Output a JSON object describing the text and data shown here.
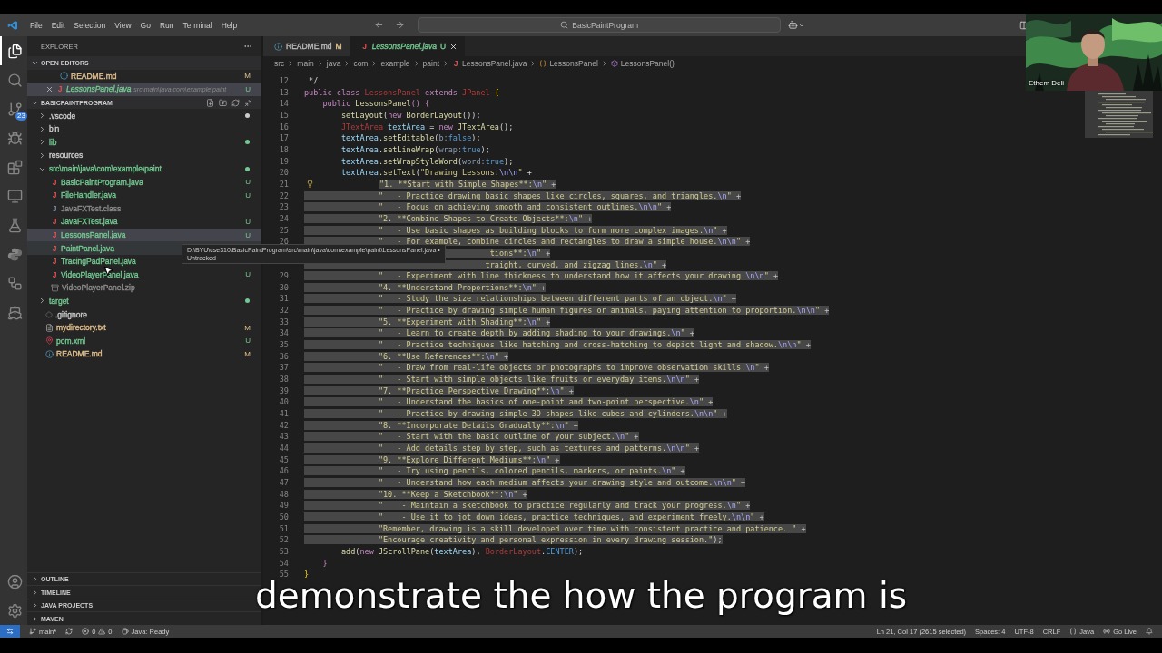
{
  "title_bar": {
    "menus": [
      "File",
      "Edit",
      "Selection",
      "View",
      "Go",
      "Run",
      "Terminal",
      "Help"
    ],
    "search": "BasicPaintProgram"
  },
  "activity_bar": {
    "items": [
      {
        "kind": "explorer",
        "selected": true
      },
      {
        "kind": "search",
        "selected": false
      },
      {
        "kind": "source_control",
        "selected": false,
        "badge": "23"
      },
      {
        "kind": "run",
        "selected": false
      },
      {
        "kind": "extensions",
        "selected": false
      },
      {
        "kind": "remote",
        "selected": false
      },
      {
        "kind": "testing",
        "selected": false
      },
      {
        "kind": "python",
        "selected": false
      },
      {
        "kind": "workflow",
        "selected": false
      },
      {
        "kind": "docker",
        "selected": false
      }
    ],
    "bottom": [
      {
        "kind": "account"
      },
      {
        "kind": "settings"
      }
    ]
  },
  "sidebar": {
    "title": "EXPLORER",
    "open_editors": {
      "title": "OPEN EDITORS",
      "expanded": true,
      "items": [
        {
          "name": "README.md",
          "kind": "md",
          "badge": "M",
          "color": "#e2c08d",
          "selected": false
        },
        {
          "name": "LessonsPanel.java",
          "kind": "java",
          "glyph": "J",
          "path": "src\\main\\java\\com\\example\\paint",
          "badge": "U",
          "color": "#73c991",
          "selected": true
        }
      ]
    },
    "project": {
      "title": "BASICPAINTPROGRAM",
      "expanded": true,
      "items": [
        {
          "name": ".vscode",
          "kind": "folder",
          "expanded": false,
          "color": "#cccccc",
          "dot": true,
          "selected": false,
          "hovered": false
        },
        {
          "name": "bin",
          "kind": "folder",
          "expanded": false,
          "color": "#cccccc",
          "dot": false,
          "selected": false,
          "hovered": false
        },
        {
          "name": "lib",
          "kind": "folder",
          "expanded": false,
          "color": "#73c991",
          "dot": true,
          "selected": false,
          "hovered": false
        },
        {
          "name": "resources",
          "kind": "folder",
          "expanded": false,
          "color": "#cccccc",
          "dot": false,
          "selected": false,
          "hovered": false
        },
        {
          "name": "src\\main\\java\\com\\example\\paint",
          "kind": "folder",
          "expanded": true,
          "color": "#73c991",
          "dot": true,
          "selected": false,
          "hovered": false,
          "children": [
            {
              "name": "BasicPaintProgram.java",
              "kind": "java",
              "glyph": "J",
              "color": "#73c991",
              "badge": "U",
              "selected": false,
              "hovered": false
            },
            {
              "name": "FileHandler.java",
              "kind": "java",
              "glyph": "J",
              "color": "#73c991",
              "badge": "U",
              "selected": false,
              "hovered": false
            },
            {
              "name": "JavaFXTest.class",
              "kind": "class",
              "glyph": "J",
              "color": "#8c8c8c",
              "selected": false,
              "hovered": false
            },
            {
              "name": "JavaFXTest.java",
              "kind": "java",
              "glyph": "J",
              "color": "#73c991",
              "badge": "U",
              "selected": false,
              "hovered": false
            },
            {
              "name": "LessonsPanel.java",
              "kind": "java",
              "glyph": "J",
              "color": "#73c991",
              "badge": "U",
              "selected": true,
              "hovered": false
            },
            {
              "name": "PaintPanel.java",
              "kind": "java",
              "glyph": "J",
              "color": "#73c991",
              "selected": false,
              "hovered": true
            },
            {
              "name": "TracingPadPanel.java",
              "kind": "java",
              "glyph": "J",
              "color": "#73c991",
              "selected": false,
              "hovered": false
            },
            {
              "name": "VideoPlayerPanel.java",
              "kind": "java",
              "glyph": "J",
              "color": "#73c991",
              "badge": "U",
              "selected": false,
              "hovered": false
            },
            {
              "name": "VideoPlayerPanel.zip",
              "kind": "zip",
              "color": "#8c8c8c",
              "selected": false,
              "hovered": false
            }
          ]
        },
        {
          "name": "target",
          "kind": "folder",
          "expanded": false,
          "color": "#73c991",
          "dot": true,
          "selected": false,
          "hovered": false
        },
        {
          "name": ".gitignore",
          "kind": "git",
          "color": "#cccccc",
          "selected": false,
          "hovered": false
        },
        {
          "name": "mydirectory.txt",
          "kind": "txt",
          "color": "#e2c08d",
          "badge": "M",
          "selected": false,
          "hovered": false
        },
        {
          "name": "pom.xml",
          "kind": "xml",
          "color": "#73c991",
          "badge": "U",
          "selected": false,
          "hovered": false
        },
        {
          "name": "README.md",
          "kind": "md",
          "color": "#e2c08d",
          "badge": "M",
          "selected": false,
          "hovered": false
        }
      ]
    },
    "sections": [
      {
        "title": "OUTLINE",
        "expanded": false
      },
      {
        "title": "TIMELINE",
        "expanded": false
      },
      {
        "title": "JAVA PROJECTS",
        "expanded": false
      },
      {
        "title": "MAVEN",
        "expanded": false
      }
    ]
  },
  "editor": {
    "tabs": [
      {
        "label": "README.md",
        "kind": "md",
        "badge": "M",
        "color": "#e2c08d",
        "selected": false,
        "closable": false
      },
      {
        "label": "LessonsPanel.java",
        "kind": "java",
        "glyph": "J",
        "badge": "U",
        "color": "#73c991",
        "selected": true,
        "closable": true
      }
    ],
    "breadcrumb": [
      {
        "kind": "folder",
        "text": "src"
      },
      {
        "kind": "folder",
        "text": "main"
      },
      {
        "kind": "folder",
        "text": "java"
      },
      {
        "kind": "folder",
        "text": "com"
      },
      {
        "kind": "folder",
        "text": "example"
      },
      {
        "kind": "folder",
        "text": "paint"
      },
      {
        "kind": "file",
        "glyph": "J",
        "text": "LessonsPanel.java"
      },
      {
        "kind": "class",
        "text": "LessonsPanel"
      },
      {
        "kind": "method",
        "text": "LessonsPanel()"
      }
    ],
    "lines": [
      {
        "number": "12",
        "selected": false,
        "segments": [
          {
            "kind": "comment",
            "text": " */"
          }
        ]
      },
      {
        "number": "13",
        "selected": false,
        "segments": [
          {
            "kind": "kw",
            "text": "public class "
          },
          {
            "kind": "err",
            "text": "LessonsPanel"
          },
          {
            "kind": "kw",
            "text": " extends "
          },
          {
            "kind": "err",
            "text": "JPanel"
          },
          {
            "kind": "brace",
            "text": " {"
          }
        ]
      },
      {
        "number": "14",
        "selected": false,
        "segments": [
          {
            "kind": "kw",
            "text": "    public "
          },
          {
            "kind": "fn",
            "text": "LessonsPanel"
          },
          {
            "kind": "kw",
            "text": "() {"
          }
        ]
      },
      {
        "number": "15",
        "selected": false,
        "segments": [
          {
            "kind": "fn",
            "text": "        setLayout"
          },
          {
            "kind": "op",
            "text": "("
          },
          {
            "kind": "kw",
            "text": "new "
          },
          {
            "kind": "fn",
            "text": "BorderLayout"
          },
          {
            "kind": "op",
            "text": "());"
          }
        ]
      },
      {
        "number": "16",
        "selected": false,
        "segments": [
          {
            "kind": "err",
            "text": "        JTextArea"
          },
          {
            "kind": "var",
            "text": " textArea"
          },
          {
            "kind": "op",
            "text": " = "
          },
          {
            "kind": "kw",
            "text": "new "
          },
          {
            "kind": "fn",
            "text": "JTextArea"
          },
          {
            "kind": "op",
            "text": "();"
          }
        ]
      },
      {
        "number": "17",
        "selected": false,
        "segments": [
          {
            "kind": "var",
            "text": "        textArea"
          },
          {
            "kind": "op",
            "text": "."
          },
          {
            "kind": "fn",
            "text": "setEditable"
          },
          {
            "kind": "op",
            "text": "("
          },
          {
            "kind": "hint",
            "text": "b:"
          },
          {
            "kind": "lit",
            "text": "false"
          },
          {
            "kind": "op",
            "text": ");"
          }
        ]
      },
      {
        "number": "18",
        "selected": false,
        "segments": [
          {
            "kind": "var",
            "text": "        textArea"
          },
          {
            "kind": "op",
            "text": "."
          },
          {
            "kind": "fn",
            "text": "setLineWrap"
          },
          {
            "kind": "op",
            "text": "("
          },
          {
            "kind": "hint",
            "text": "wrap:"
          },
          {
            "kind": "lit",
            "text": "true"
          },
          {
            "kind": "op",
            "text": ");"
          }
        ]
      },
      {
        "number": "19",
        "selected": false,
        "segments": [
          {
            "kind": "var",
            "text": "        textArea"
          },
          {
            "kind": "op",
            "text": "."
          },
          {
            "kind": "fn",
            "text": "setWrapStyleWord"
          },
          {
            "kind": "op",
            "text": "("
          },
          {
            "kind": "hint",
            "text": "word:"
          },
          {
            "kind": "lit",
            "text": "true"
          },
          {
            "kind": "op",
            "text": ");"
          }
        ]
      },
      {
        "number": "20",
        "selected": false,
        "segments": [
          {
            "kind": "var",
            "text": "        textArea"
          },
          {
            "kind": "op",
            "text": "."
          },
          {
            "kind": "fn",
            "text": "setText"
          },
          {
            "kind": "op",
            "text": "("
          },
          {
            "kind": "str",
            "text": "\"Drawing Lessons:"
          },
          {
            "kind": "esc",
            "text": "\\n\\n"
          },
          {
            "kind": "str",
            "text": "\""
          },
          {
            "kind": "op",
            "text": " +"
          }
        ]
      },
      {
        "number": "21",
        "selected": true,
        "caret": true,
        "lightbulb": true,
        "segments": [
          {
            "kind": "str",
            "text": "                \"1. **Start with Simple Shapes**:"
          },
          {
            "kind": "esc",
            "text": "\\n"
          },
          {
            "kind": "str",
            "text": "\""
          },
          {
            "kind": "plus",
            "text": " +"
          }
        ]
      },
      {
        "number": "22",
        "selected": true,
        "segments": [
          {
            "kind": "str",
            "text": "                \"   - Practice drawing basic shapes like circles, squares, and triangles."
          },
          {
            "kind": "esc",
            "text": "\\n"
          },
          {
            "kind": "str",
            "text": "\""
          },
          {
            "kind": "plus",
            "text": " +"
          }
        ]
      },
      {
        "number": "23",
        "selected": true,
        "segments": [
          {
            "kind": "str",
            "text": "                \"   - Focus on achieving smooth and consistent outlines."
          },
          {
            "kind": "esc",
            "text": "\\n\\n"
          },
          {
            "kind": "str",
            "text": "\""
          },
          {
            "kind": "plus",
            "text": " +"
          }
        ]
      },
      {
        "number": "24",
        "selected": true,
        "segments": [
          {
            "kind": "str",
            "text": "                \"2. **Combine Shapes to Create Objects**:"
          },
          {
            "kind": "esc",
            "text": "\\n"
          },
          {
            "kind": "str",
            "text": "\""
          },
          {
            "kind": "plus",
            "text": " +"
          }
        ]
      },
      {
        "number": "25",
        "selected": true,
        "segments": [
          {
            "kind": "str",
            "text": "                \"   - Use basic shapes as building blocks to form more complex images."
          },
          {
            "kind": "esc",
            "text": "\\n"
          },
          {
            "kind": "str",
            "text": "\""
          },
          {
            "kind": "plus",
            "text": " +"
          }
        ]
      },
      {
        "number": "26",
        "selected": true,
        "segments": [
          {
            "kind": "str",
            "text": "                \"   - For example, combine circles and rectangles to draw a simple house."
          },
          {
            "kind": "esc",
            "text": "\\n\\n"
          },
          {
            "kind": "str",
            "text": "\""
          },
          {
            "kind": "plus",
            "text": " +"
          }
        ]
      },
      {
        "selected": true,
        "segments": [
          {
            "kind": "str",
            "text": "                                        tions**:"
          },
          {
            "kind": "esc",
            "text": "\\n"
          },
          {
            "kind": "str",
            "text": "\""
          },
          {
            "kind": "plus",
            "text": " +"
          }
        ]
      },
      {
        "selected": true,
        "segments": [
          {
            "kind": "str",
            "text": "                                       traight, curved, and zigzag lines."
          },
          {
            "kind": "esc",
            "text": "\\n"
          },
          {
            "kind": "str",
            "text": "\""
          },
          {
            "kind": "plus",
            "text": " +"
          }
        ]
      },
      {
        "number": "29",
        "selected": true,
        "segments": [
          {
            "kind": "str",
            "text": "                \"   - Experiment with line thickness to understand how it affects your drawing."
          },
          {
            "kind": "esc",
            "text": "\\n\\n"
          },
          {
            "kind": "str",
            "text": "\""
          },
          {
            "kind": "plus",
            "text": " +"
          }
        ]
      },
      {
        "number": "30",
        "selected": true,
        "segments": [
          {
            "kind": "str",
            "text": "                \"4. **Understand Proportions**:"
          },
          {
            "kind": "esc",
            "text": "\\n"
          },
          {
            "kind": "str",
            "text": "\""
          },
          {
            "kind": "plus",
            "text": " +"
          }
        ]
      },
      {
        "number": "31",
        "selected": true,
        "segments": [
          {
            "kind": "str",
            "text": "                \"   - Study the size relationships between different parts of an object."
          },
          {
            "kind": "esc",
            "text": "\\n"
          },
          {
            "kind": "str",
            "text": "\""
          },
          {
            "kind": "plus",
            "text": " +"
          }
        ]
      },
      {
        "number": "32",
        "selected": true,
        "segments": [
          {
            "kind": "str",
            "text": "                \"   - Practice by drawing simple human figures or animals, paying attention to proportion."
          },
          {
            "kind": "esc",
            "text": "\\n\\n"
          },
          {
            "kind": "str",
            "text": "\""
          },
          {
            "kind": "plus",
            "text": " +"
          }
        ]
      },
      {
        "number": "33",
        "selected": true,
        "segments": [
          {
            "kind": "str",
            "text": "                \"5. **Experiment with Shading**:"
          },
          {
            "kind": "esc",
            "text": "\\n"
          },
          {
            "kind": "str",
            "text": "\""
          },
          {
            "kind": "plus",
            "text": " +"
          }
        ]
      },
      {
        "number": "34",
        "selected": true,
        "segments": [
          {
            "kind": "str",
            "text": "                \"   - Learn to create depth by adding shading to your drawings."
          },
          {
            "kind": "esc",
            "text": "\\n"
          },
          {
            "kind": "str",
            "text": "\""
          },
          {
            "kind": "plus",
            "text": " +"
          }
        ]
      },
      {
        "number": "35",
        "selected": true,
        "segments": [
          {
            "kind": "str",
            "text": "                \"   - Practice techniques like hatching and cross-hatching to depict light and shadow."
          },
          {
            "kind": "esc",
            "text": "\\n\\n"
          },
          {
            "kind": "str",
            "text": "\""
          },
          {
            "kind": "plus",
            "text": " +"
          }
        ]
      },
      {
        "number": "36",
        "selected": true,
        "segments": [
          {
            "kind": "str",
            "text": "                \"6. **Use References**:"
          },
          {
            "kind": "esc",
            "text": "\\n"
          },
          {
            "kind": "str",
            "text": "\""
          },
          {
            "kind": "plus",
            "text": " +"
          }
        ]
      },
      {
        "number": "37",
        "selected": true,
        "segments": [
          {
            "kind": "str",
            "text": "                \"   - Draw from real-life objects or photographs to improve observation skills."
          },
          {
            "kind": "esc",
            "text": "\\n"
          },
          {
            "kind": "str",
            "text": "\""
          },
          {
            "kind": "plus",
            "text": " +"
          }
        ]
      },
      {
        "number": "38",
        "selected": true,
        "segments": [
          {
            "kind": "str",
            "text": "                \"   - Start with simple objects like fruits or everyday items."
          },
          {
            "kind": "esc",
            "text": "\\n\\n"
          },
          {
            "kind": "str",
            "text": "\""
          },
          {
            "kind": "plus",
            "text": " +"
          }
        ]
      },
      {
        "number": "39",
        "selected": true,
        "segments": [
          {
            "kind": "str",
            "text": "                \"7. **Practice Perspective Drawing**:"
          },
          {
            "kind": "esc",
            "text": "\\n"
          },
          {
            "kind": "str",
            "text": "\""
          },
          {
            "kind": "plus",
            "text": " +"
          }
        ]
      },
      {
        "number": "40",
        "selected": true,
        "segments": [
          {
            "kind": "str",
            "text": "                \"   - Understand the basics of one-point and two-point perspective."
          },
          {
            "kind": "esc",
            "text": "\\n"
          },
          {
            "kind": "str",
            "text": "\""
          },
          {
            "kind": "plus",
            "text": " +"
          }
        ]
      },
      {
        "number": "41",
        "selected": true,
        "segments": [
          {
            "kind": "str",
            "text": "                \"   - Practice by drawing simple 3D shapes like cubes and cylinders."
          },
          {
            "kind": "esc",
            "text": "\\n\\n"
          },
          {
            "kind": "str",
            "text": "\""
          },
          {
            "kind": "plus",
            "text": " +"
          }
        ]
      },
      {
        "number": "42",
        "selected": true,
        "segments": [
          {
            "kind": "str",
            "text": "                \"8. **Incorporate Details Gradually**:"
          },
          {
            "kind": "esc",
            "text": "\\n"
          },
          {
            "kind": "str",
            "text": "\""
          },
          {
            "kind": "plus",
            "text": " +"
          }
        ]
      },
      {
        "number": "43",
        "selected": true,
        "segments": [
          {
            "kind": "str",
            "text": "                \"   - Start with the basic outline of your subject."
          },
          {
            "kind": "esc",
            "text": "\\n"
          },
          {
            "kind": "str",
            "text": "\""
          },
          {
            "kind": "plus",
            "text": " +"
          }
        ]
      },
      {
        "number": "44",
        "selected": true,
        "segments": [
          {
            "kind": "str",
            "text": "                \"   - Add details step by step, such as textures and patterns."
          },
          {
            "kind": "esc",
            "text": "\\n\\n"
          },
          {
            "kind": "str",
            "text": "\""
          },
          {
            "kind": "plus",
            "text": " +"
          }
        ]
      },
      {
        "number": "45",
        "selected": true,
        "segments": [
          {
            "kind": "str",
            "text": "                \"9. **Explore Different Mediums**:"
          },
          {
            "kind": "esc",
            "text": "\\n"
          },
          {
            "kind": "str",
            "text": "\""
          },
          {
            "kind": "plus",
            "text": " +"
          }
        ]
      },
      {
        "number": "46",
        "selected": true,
        "segments": [
          {
            "kind": "str",
            "text": "                \"   - Try using pencils, colored pencils, markers, or paints."
          },
          {
            "kind": "esc",
            "text": "\\n"
          },
          {
            "kind": "str",
            "text": "\""
          },
          {
            "kind": "plus",
            "text": " +"
          }
        ]
      },
      {
        "number": "47",
        "selected": true,
        "segments": [
          {
            "kind": "str",
            "text": "                \"   - Understand how each medium affects your drawing style and outcome."
          },
          {
            "kind": "esc",
            "text": "\\n\\n"
          },
          {
            "kind": "str",
            "text": "\""
          },
          {
            "kind": "plus",
            "text": " +"
          }
        ]
      },
      {
        "number": "48",
        "selected": true,
        "segments": [
          {
            "kind": "str",
            "text": "                \"10. **Keep a Sketchbook**:"
          },
          {
            "kind": "esc",
            "text": "\\n"
          },
          {
            "kind": "str",
            "text": "\""
          },
          {
            "kind": "plus",
            "text": " +"
          }
        ]
      },
      {
        "number": "49",
        "selected": true,
        "segments": [
          {
            "kind": "str",
            "text": "                \"    - Maintain a sketchbook to practice regularly and track your progress."
          },
          {
            "kind": "esc",
            "text": "\\n"
          },
          {
            "kind": "str",
            "text": "\""
          },
          {
            "kind": "plus",
            "text": " +"
          }
        ]
      },
      {
        "number": "50",
        "selected": true,
        "segments": [
          {
            "kind": "str",
            "text": "                \"    - Use it to jot down ideas, practice techniques, and experiment freely."
          },
          {
            "kind": "esc",
            "text": "\\n\\n"
          },
          {
            "kind": "str",
            "text": "\""
          },
          {
            "kind": "plus",
            "text": " +"
          }
        ]
      },
      {
        "number": "51",
        "selected": true,
        "segments": [
          {
            "kind": "str",
            "text": "                \"Remember, drawing is a skill developed over time with consistent practice and patience. \""
          },
          {
            "kind": "plus",
            "text": " +"
          }
        ]
      },
      {
        "number": "52",
        "selected": true,
        "segments": [
          {
            "kind": "str",
            "text": "                \"Encourage creativity and personal expression in every drawing session.\""
          },
          {
            "kind": "op",
            "text": ");"
          }
        ]
      },
      {
        "number": "53",
        "selected": false,
        "segments": [
          {
            "kind": "fn",
            "text": "        add"
          },
          {
            "kind": "op",
            "text": "("
          },
          {
            "kind": "kw",
            "text": "new "
          },
          {
            "kind": "fn",
            "text": "JScrollPane"
          },
          {
            "kind": "op",
            "text": "("
          },
          {
            "kind": "var",
            "text": "textArea"
          },
          {
            "kind": "op",
            "text": "), "
          },
          {
            "kind": "err",
            "text": "BorderLayout"
          },
          {
            "kind": "op",
            "text": "."
          },
          {
            "kind": "lit",
            "text": "CENTER"
          },
          {
            "kind": "op",
            "text": ");"
          }
        ]
      },
      {
        "number": "54",
        "selected": false,
        "segments": [
          {
            "kind": "kw",
            "text": "    }"
          }
        ]
      },
      {
        "number": "55",
        "selected": false,
        "segments": [
          {
            "kind": "brace",
            "text": "}"
          }
        ]
      }
    ]
  },
  "tooltip": {
    "path": "D:\\BYU\\cse310\\BasicPaintProgram\\src\\main\\java\\com\\example\\paint\\LessonsPanel.java •",
    "status": "Untracked"
  },
  "status_bar": {
    "branch": "main*",
    "errors": "0",
    "warnings": "0",
    "java_status": "Java: Ready",
    "cursor": "Ln 21, Col 17 (2615 selected)",
    "spaces": "Spaces: 4",
    "encoding": "UTF-8",
    "eol": "CRLF",
    "language": "Java",
    "go_live": "Go Live"
  },
  "webcam": {
    "kind": "picture",
    "name": "Ethem Deli"
  },
  "subtitle": "demonstrate the how the program is"
}
